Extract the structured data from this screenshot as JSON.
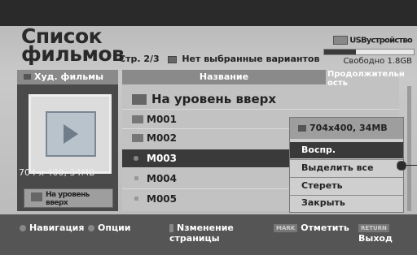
{
  "header": {
    "title_line1": "Список",
    "title_line2": "фильмов",
    "page_label": "Стр. 2/3",
    "selection_status": "Нет выбранные вариантов",
    "usb_label": "USBустройство",
    "free_label": "Свободно 1.8GB",
    "storage_used_fraction": 0.35
  },
  "preview": {
    "category": "Худ. фильмы",
    "resolution": "704 x 400, 34MB",
    "up_button": "На уровень вверх"
  },
  "list": {
    "column_name": "Название",
    "column_duration": "Продолжительн ость",
    "up_item": "На уровень вверх",
    "items": [
      "M001",
      "M002",
      "M003",
      "M004",
      "M005"
    ],
    "selected_index": 2
  },
  "popup": {
    "info": "704x400, 34MB",
    "items": [
      "Воспр.",
      "Выделить все",
      "Стереть",
      "Закрыть"
    ],
    "active_index": 0
  },
  "footer": {
    "navigation": "Навигация",
    "options": "Опции",
    "page_change": "Nзменение страницы",
    "mark_tag": "MARK",
    "mark": "Отметить",
    "return_tag": "RETURN",
    "exit": "Выход"
  },
  "colors": {
    "panel_dark": "#4a4a4a",
    "selection": "#3a3a3a",
    "header_bar": "#8a8a8a"
  }
}
